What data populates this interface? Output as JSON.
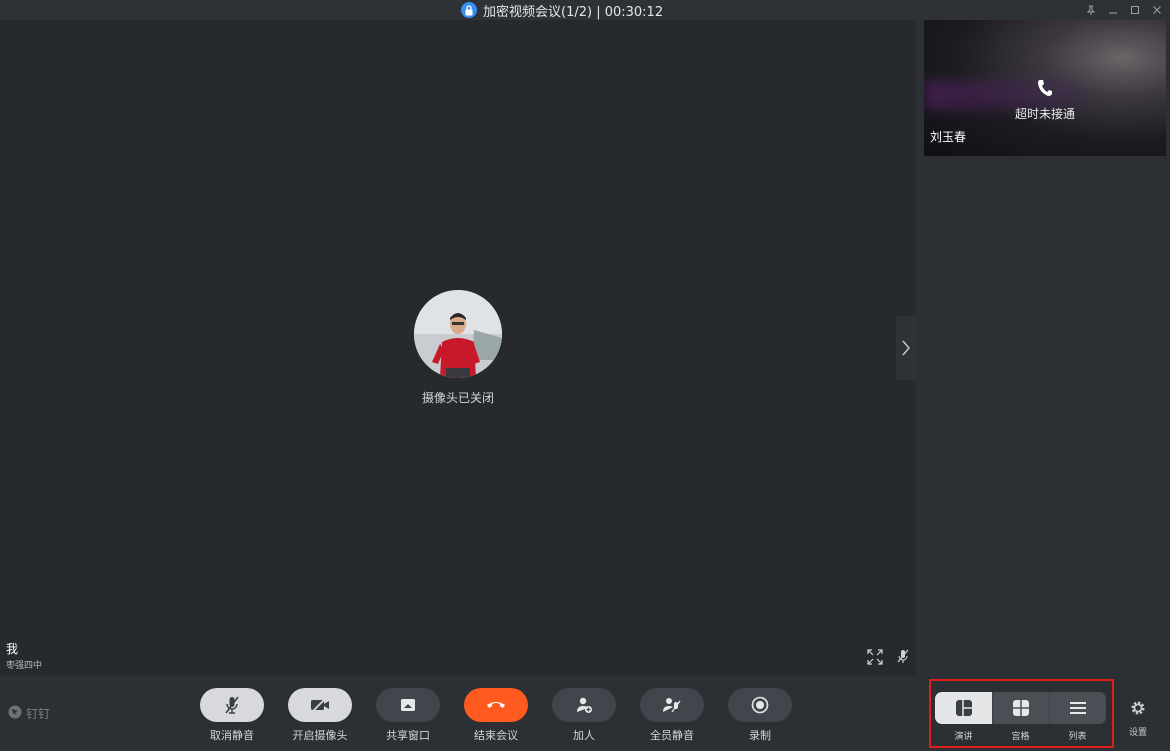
{
  "window": {
    "title": "加密视频会议(1/2) | 00:30:12",
    "controls": [
      "pin-icon",
      "minimize-icon",
      "maximize-icon",
      "close-icon"
    ]
  },
  "main": {
    "camera_status": "摄像头已关闭",
    "self_name": "我",
    "self_org": "枣强四中"
  },
  "side": {
    "participant": {
      "name": "刘玉春",
      "status": "超时未接通"
    }
  },
  "toolbar": {
    "brand": "钉钉",
    "buttons": [
      {
        "label": "取消静音",
        "icon": "mic-muted-icon"
      },
      {
        "label": "开启摄像头",
        "icon": "camera-off-icon"
      },
      {
        "label": "共享窗口",
        "icon": "share-window-icon"
      },
      {
        "label": "结束会议",
        "icon": "hangup-icon"
      },
      {
        "label": "加人",
        "icon": "add-person-icon"
      },
      {
        "label": "全员静音",
        "icon": "mute-all-icon"
      },
      {
        "label": "录制",
        "icon": "record-icon"
      }
    ],
    "layouts": [
      {
        "label": "演讲",
        "icon": "speaker-layout-icon",
        "active": true
      },
      {
        "label": "宫格",
        "icon": "grid-layout-icon",
        "active": false
      },
      {
        "label": "列表",
        "icon": "list-layout-icon",
        "active": false
      }
    ],
    "settings_label": "设置"
  },
  "colors": {
    "background": "#26292e",
    "toolbar": "#2c2f34",
    "end_call": "#ff5a1f",
    "highlight_border": "#e21b1b",
    "lock_badge": "#3a8ff5"
  }
}
